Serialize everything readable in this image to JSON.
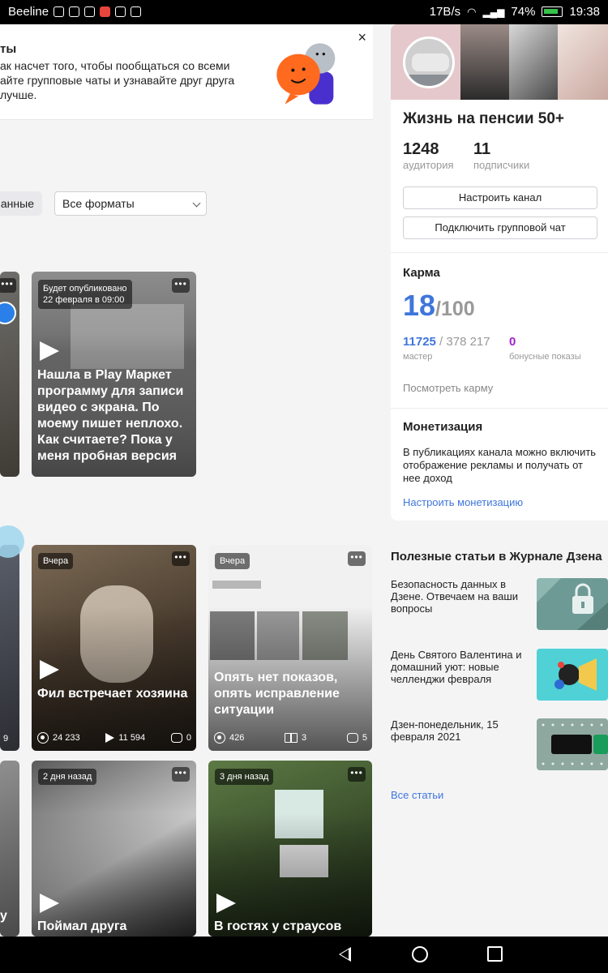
{
  "status_bar": {
    "carrier": "Beeline",
    "speed": "17B/s",
    "battery": "74%",
    "time": "19:38"
  },
  "banner": {
    "title": "ты",
    "line1": "ак насчет того, чтобы пообщаться со всеми",
    "line2": "айте групповые чаты и узнавайте друг друга лучше.",
    "close_label": "×"
  },
  "filters": {
    "type_pill": "анные",
    "format_value": "Все форматы"
  },
  "cards": {
    "c1": {
      "chip": "Будет опубликовано\n22 февраля в 09:00",
      "title": "Нашла в Play Маркет программу для записи видео с экрана. По моему пишет неплохо. Как считаете? Пока у меня пробная версия"
    },
    "c2": {
      "chip": "Вчера",
      "title": "Фил встречает хозяина",
      "views": "24 233",
      "plays": "11 594",
      "comments": "0"
    },
    "c3": {
      "chip": "Вчера",
      "title": "Опять нет показов, опять исправление ситуации",
      "views": "426",
      "reads": "3",
      "comments": "5"
    },
    "c4": {
      "chip": "2 дня назад",
      "title": "Поймал друга"
    },
    "c5": {
      "chip": "3 дня назад",
      "title": "В гостях у страусов"
    },
    "left_partial_stat": "9",
    "left_partial_title": "у",
    "more_label": "•••"
  },
  "sidebar": {
    "channel_name": "Жизнь на пенсии 50+",
    "audience_value": "1248",
    "audience_label": "аудитория",
    "subscribers_value": "11",
    "subscribers_label": "подписчики",
    "btn_setup": "Настроить канал",
    "btn_chat": "Подключить групповой чат",
    "karma_title": "Карма",
    "karma_value": "18",
    "karma_max": "/100",
    "master_value": "11725",
    "master_total": " / 378 217",
    "master_label": "мастер",
    "bonus_value": "0",
    "bonus_label": "бонусные показы",
    "see_karma": "Посмотреть карму",
    "monet_title": "Монетизация",
    "monet_text": "В публикациях канала можно включить отображение рекламы и получать от нее доход",
    "monet_link": "Настроить монетизацию"
  },
  "articles": {
    "title": "Полезные статьи в Журнале Дзена",
    "items": [
      {
        "title": "Безопасность данных в Дзене. Отвечаем на ваши вопросы"
      },
      {
        "title": "День Святого Валентина и домашний уют: новые челленджи февраля"
      },
      {
        "title": "Дзен-понедельник, 15 февраля 2021"
      }
    ],
    "all_link": "Все статьи"
  },
  "colors": {
    "accent_blue": "#3f76db",
    "bonus_purple": "#a023ce",
    "statusbar": "#000000"
  }
}
